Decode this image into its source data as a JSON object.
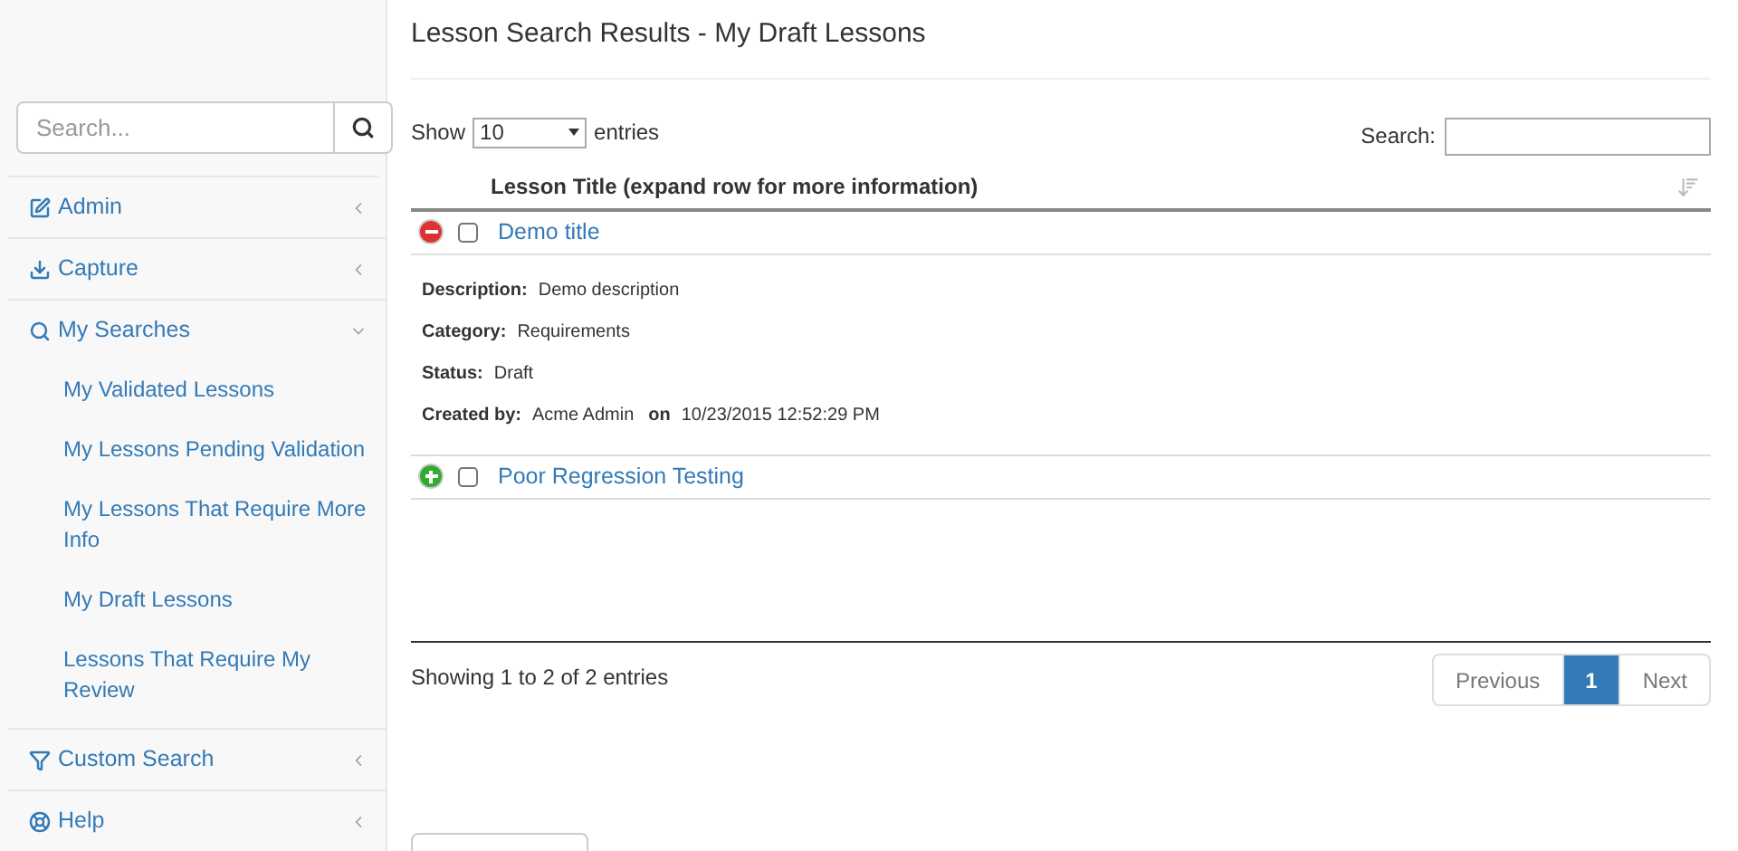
{
  "sidebar": {
    "search": {
      "placeholder": "Search..."
    },
    "items": [
      {
        "label": "Admin",
        "expanded": false
      },
      {
        "label": "Capture",
        "expanded": false
      },
      {
        "label": "My Searches",
        "expanded": true,
        "children": [
          {
            "label": "My Validated Lessons"
          },
          {
            "label": "My Lessons Pending Validation"
          },
          {
            "label": "My Lessons That Require More Info"
          },
          {
            "label": "My Draft Lessons"
          },
          {
            "label": "Lessons That Require My Review"
          }
        ]
      },
      {
        "label": "Custom Search",
        "expanded": false
      },
      {
        "label": "Help",
        "expanded": false
      }
    ]
  },
  "page_title": "Lesson Search Results - My Draft Lessons",
  "length": {
    "label_before": "Show",
    "value": "10",
    "label_after": "entries"
  },
  "filter": {
    "label": "Search:"
  },
  "table": {
    "column": "Lesson Title (expand row for more information)",
    "rows": [
      {
        "title": "Demo title",
        "expanded": true,
        "checked": false,
        "details": [
          {
            "label": "Description:",
            "value": "Demo description"
          },
          {
            "label": "Category:",
            "value": "Requirements"
          },
          {
            "label": "Status:",
            "value": "Draft"
          },
          {
            "label": "Created by:",
            "value": "Acme Admin",
            "label_2": "on",
            "value_2": "10/23/2015 12:52:29 PM"
          }
        ]
      },
      {
        "title": "Poor Regression Testing",
        "expanded": false,
        "checked": false
      }
    ]
  },
  "info": "Showing 1 to 2 of 2 entries",
  "pagination": [
    {
      "label": "Previous",
      "selected": false
    },
    {
      "label": "1",
      "selected": true
    },
    {
      "label": "Next",
      "selected": false
    }
  ]
}
